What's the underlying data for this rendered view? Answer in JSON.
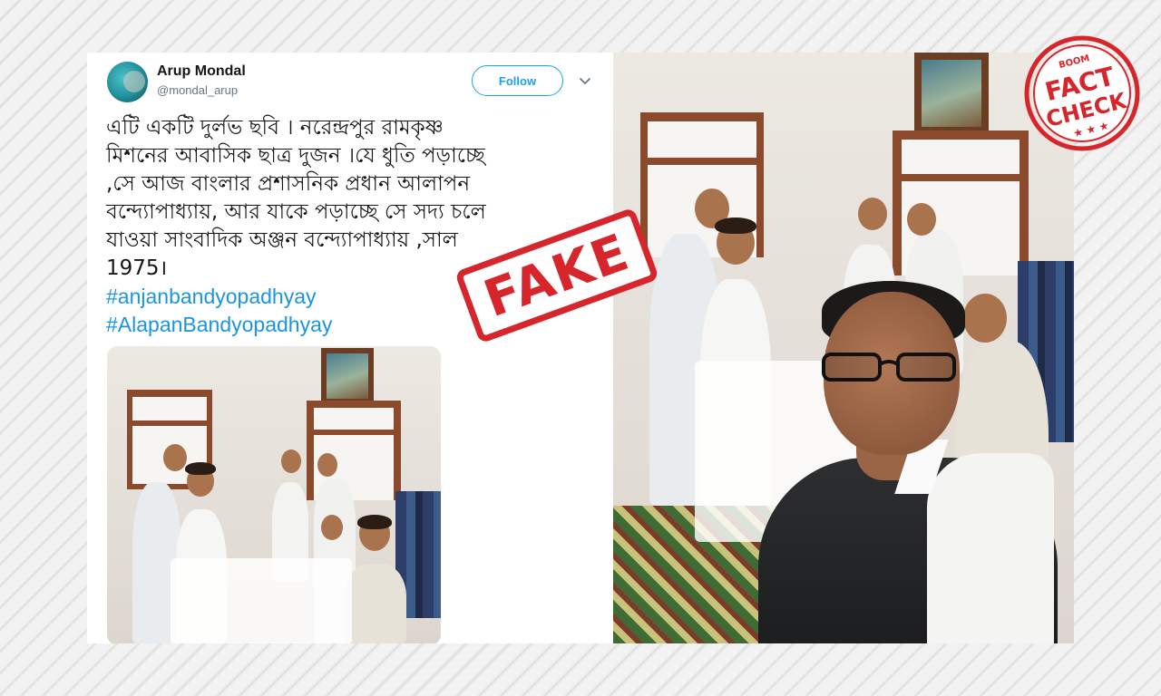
{
  "tweet": {
    "user_name": "Arup Mondal",
    "user_handle": "@mondal_arup",
    "follow_label": "Follow",
    "text_lines": [
      "এটি একটি দুর্লভ ছবি । নরেন্দ্রপুর রামকৃষ্ণ",
      "মিশনের আবাসিক ছাত্র দুজন ।যে ধুতি পড়াচ্ছে",
      ",সে আজ বাংলার প্রশাসনিক প্রধান আলাপন",
      "বন্দ্যোপাধ্যায়, আর যাকে পড়াচ্ছে সে সদ্য চলে",
      "যাওয়া সাংবাদিক অঞ্জন বন্দ্যোপাধ্যায় ,সাল",
      "1975।"
    ],
    "hashtags": [
      "#anjanbandyopadhyay",
      "#AlapanBandyopadhyay"
    ]
  },
  "overlay": {
    "stamp_text": "FAKE",
    "logo_brand": "BOOM",
    "logo_line1": "FACT",
    "logo_line2": "CHECK"
  },
  "colors": {
    "accent": "#1da1f2",
    "hashtag": "#1b95e0",
    "stamp_red": "#d7262b"
  },
  "icons": {
    "more_menu": "chevron-down-icon",
    "logo": "fact-check-logo"
  }
}
